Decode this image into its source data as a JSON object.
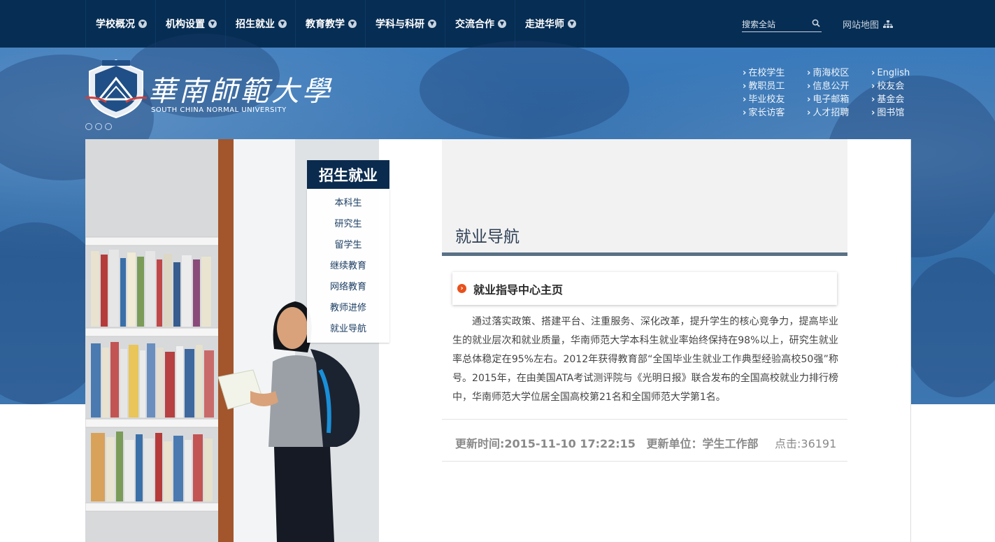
{
  "topnav": {
    "items": [
      {
        "label": "学校概况"
      },
      {
        "label": "机构设置"
      },
      {
        "label": "招生就业"
      },
      {
        "label": "教育教学"
      },
      {
        "label": "学科与科研"
      },
      {
        "label": "交流合作"
      },
      {
        "label": "走进华师"
      }
    ],
    "search_placeholder": "搜索全站",
    "sitemap_label": "网站地图",
    "search_icon": "search-icon",
    "sitemap_icon": "sitemap-icon"
  },
  "header": {
    "logo_cn": "華南師範大學",
    "logo_en": "SOUTH CHINA NORMAL UNIVERSITY",
    "quick_links": [
      {
        "label": "在校学生"
      },
      {
        "label": "南海校区"
      },
      {
        "label": "English"
      },
      {
        "label": "教职员工"
      },
      {
        "label": "信息公开"
      },
      {
        "label": "校友会"
      },
      {
        "label": "毕业校友"
      },
      {
        "label": "电子邮箱"
      },
      {
        "label": "基金会"
      },
      {
        "label": "家长访客"
      },
      {
        "label": "人才招聘"
      },
      {
        "label": "图书馆"
      }
    ]
  },
  "sidemenu": {
    "title": "招生就业",
    "items": [
      {
        "label": "本科生"
      },
      {
        "label": "研究生"
      },
      {
        "label": "留学生"
      },
      {
        "label": "继续教育"
      },
      {
        "label": "网络教育"
      },
      {
        "label": "教师进修"
      },
      {
        "label": "就业导航"
      }
    ]
  },
  "article": {
    "section_title": "就业导航",
    "card_title": "就业指导中心主页",
    "body": "通过落实政策、搭建平台、注重服务、深化改革，提升学生的核心竞争力，提高毕业生的就业层次和就业质量，华南师范大学本科生就业率始终保持在98%以上，研究生就业率总体稳定在95%左右。2012年获得教育部“全国毕业生就业工作典型经验高校50强”称号。2015年，在由美国ATA考试测评院与《光明日报》联合发布的全国高校就业力排行榜中，华南师范大学位居全国高校第21名和全国师范大学第1名。",
    "update_time": "更新时间:2015-11-10 17:22:15",
    "update_unit": "更新单位：学生工作部",
    "hits": "点击:36191"
  },
  "colors": {
    "nav_bg": "#062d53",
    "banner_blue": "#3a7bbd",
    "menu_head": "#0a2b4e",
    "accent_orange": "#e8511c"
  }
}
